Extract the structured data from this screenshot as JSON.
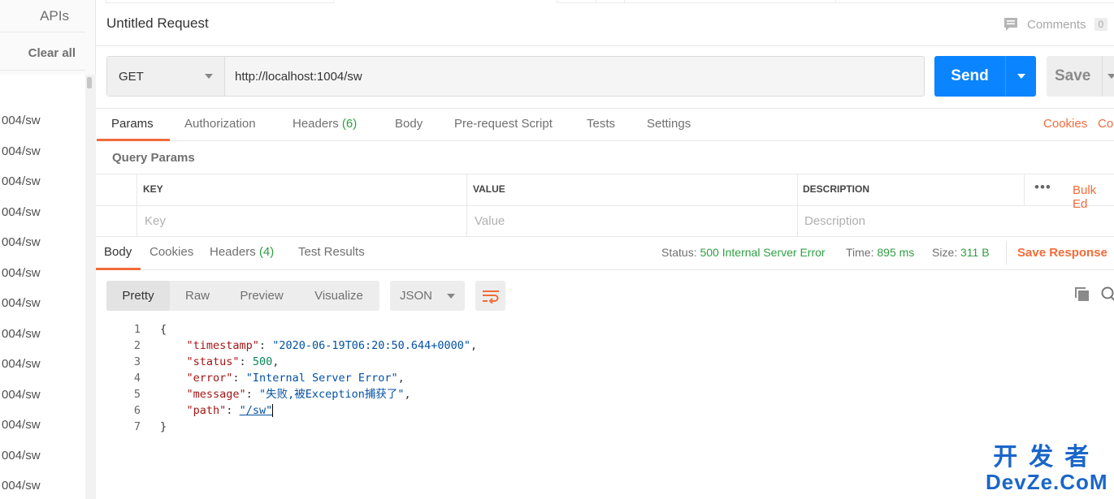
{
  "sidebar": {
    "apis_label": "APIs",
    "clear_all_label": "Clear all",
    "history": [
      "004/sw",
      "004/sw",
      "004/sw",
      "004/sw",
      "004/sw",
      "004/sw",
      "004/sw",
      "004/sw",
      "004/sw",
      "004/sw",
      "004/sw",
      "004/sw",
      "004/sw"
    ]
  },
  "request": {
    "title": "Untitled Request",
    "comments_label": "Comments",
    "comments_count": "0",
    "method": "GET",
    "url": "http://localhost:1004/sw",
    "send_label": "Send",
    "save_label": "Save"
  },
  "request_tabs": {
    "params": "Params",
    "authorization": "Authorization",
    "headers": "Headers",
    "headers_count": "(6)",
    "body": "Body",
    "pre_request": "Pre-request Script",
    "tests": "Tests",
    "settings": "Settings",
    "cookies": "Cookies",
    "code": "Co"
  },
  "query_params": {
    "title": "Query Params",
    "columns": [
      "KEY",
      "VALUE",
      "DESCRIPTION"
    ],
    "placeholders": [
      "Key",
      "Value",
      "Description"
    ],
    "more_label": "•••",
    "bulk_edit": "Bulk Ed"
  },
  "response_tabs": {
    "body": "Body",
    "cookies": "Cookies",
    "headers": "Headers",
    "headers_count": "(4)",
    "test_results": "Test Results",
    "status_label": "Status:",
    "status_value": "500 Internal Server Error",
    "time_label": "Time:",
    "time_value": "895 ms",
    "size_label": "Size:",
    "size_value": "311 B",
    "save_response": "Save Response"
  },
  "body_view": {
    "modes": [
      "Pretty",
      "Raw",
      "Preview",
      "Visualize"
    ],
    "active_mode": "Pretty",
    "format": "JSON"
  },
  "response_json": {
    "timestamp_key": "\"timestamp\"",
    "timestamp_val": "\"2020-06-19T06:20:50.644+0000\"",
    "status_key": "\"status\"",
    "status_val": "500",
    "error_key": "\"error\"",
    "error_val": "\"Internal Server Error\"",
    "message_key": "\"message\"",
    "message_val": "\"失败,被Exception捕获了\"",
    "path_key": "\"path\"",
    "path_val": "\"/sw\"",
    "line_numbers": [
      "1",
      "2",
      "3",
      "4",
      "5",
      "6",
      "7"
    ]
  },
  "watermark": {
    "top": "开发者",
    "bottom": "DevZe.CoM"
  },
  "colors": {
    "accent_orange": "#f26b3a",
    "send_blue": "#0a84ff",
    "status_green": "#2f9e44"
  }
}
